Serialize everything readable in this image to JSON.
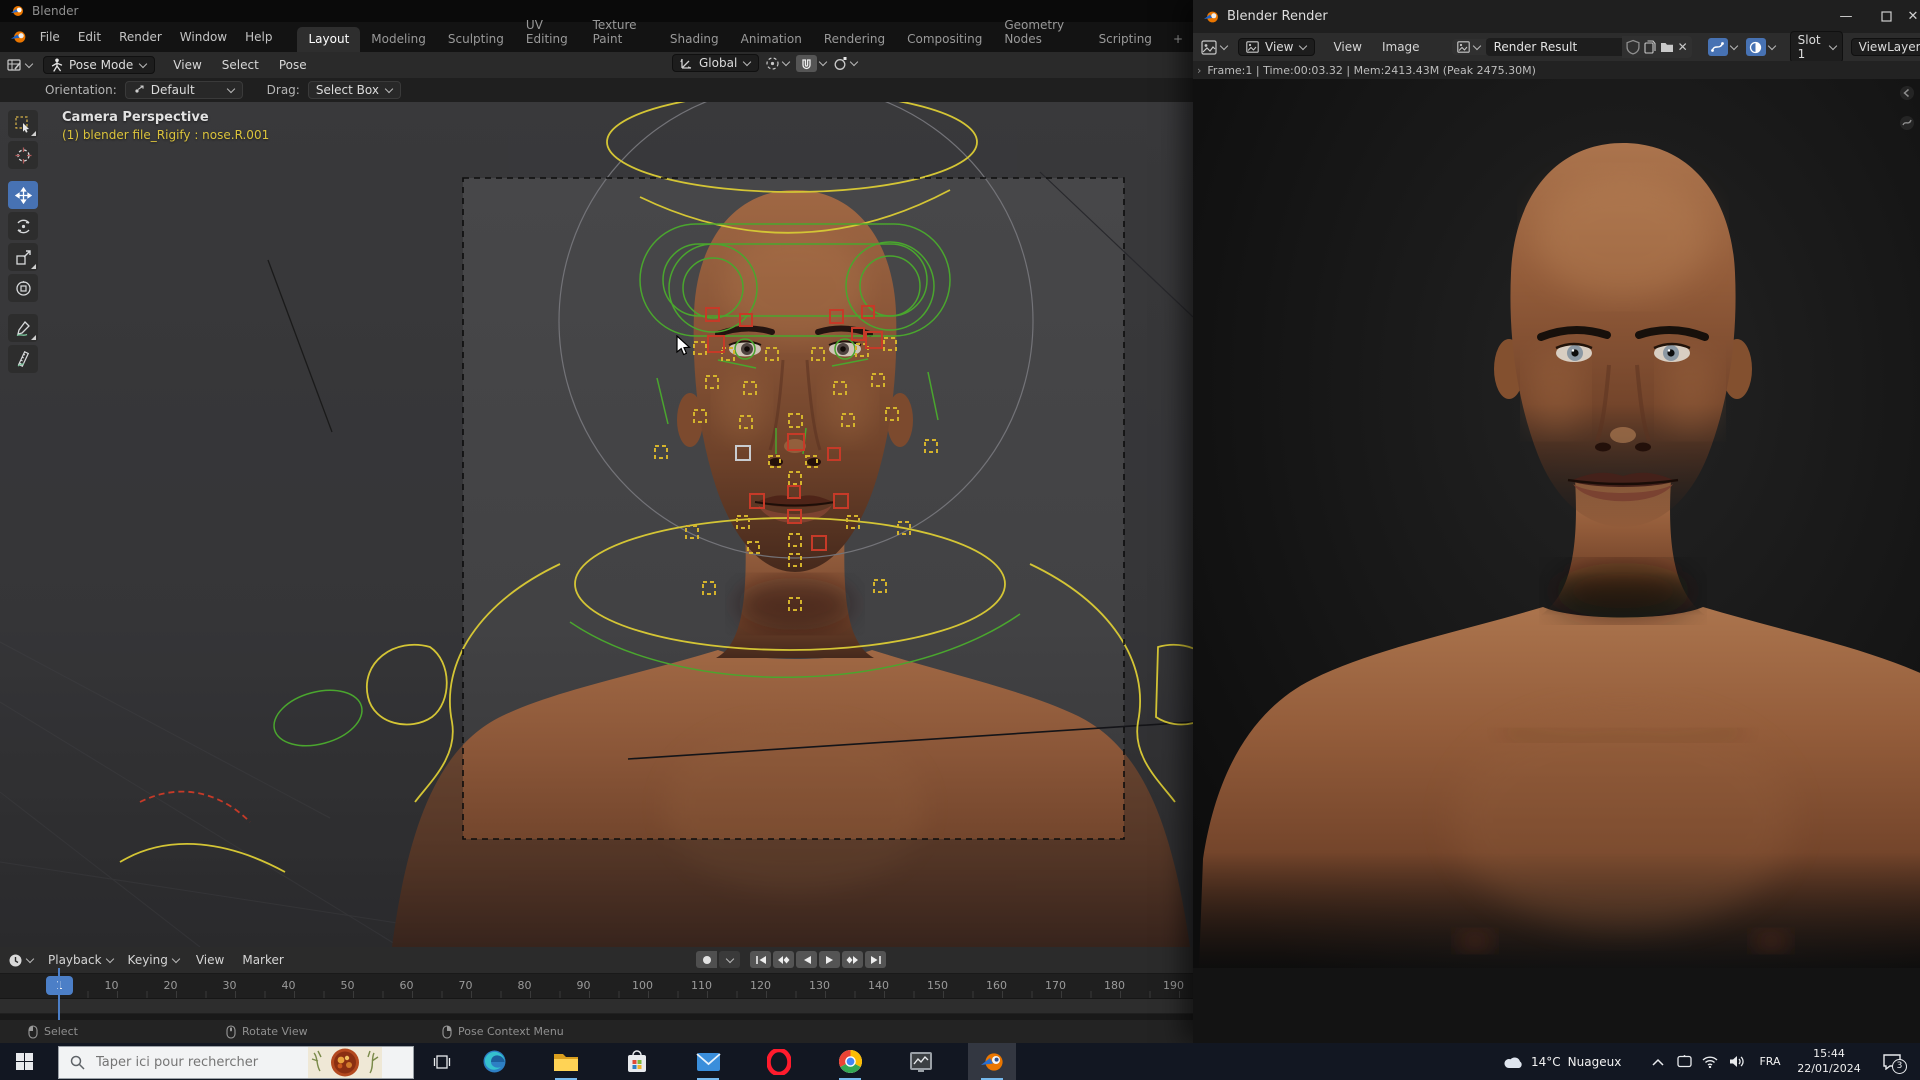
{
  "os": {
    "main_title": "Blender"
  },
  "topbar": {
    "menus": [
      "File",
      "Edit",
      "Render",
      "Window",
      "Help"
    ],
    "workspaces": [
      "Layout",
      "Modeling",
      "Sculpting",
      "UV Editing",
      "Texture Paint",
      "Shading",
      "Animation",
      "Rendering",
      "Compositing",
      "Geometry Nodes",
      "Scripting"
    ],
    "new_tab": "+"
  },
  "vp_header": {
    "mode": "Pose Mode",
    "menus": [
      "View",
      "Select",
      "Pose"
    ],
    "orientation": "Global"
  },
  "tool_settings": {
    "orientation_label": "Orientation:",
    "orientation_value": "Default",
    "drag_label": "Drag:",
    "drag_value": "Select Box"
  },
  "viewport": {
    "view_label": "Camera Perspective",
    "breadcrumb": "(1) blender file_Rigify : nose.R.001",
    "tools": [
      "tweak-select",
      "cursor",
      "move",
      "rotate",
      "scale",
      "transform",
      "annotate",
      "measure"
    ],
    "active_tool": "move"
  },
  "timeline": {
    "menus": [
      "Playback",
      "Keying",
      "View",
      "Marker"
    ],
    "current_frame": "1",
    "frame_labels": [
      "10",
      "20",
      "30",
      "40",
      "50",
      "60",
      "70",
      "80",
      "90",
      "100",
      "110",
      "120",
      "130",
      "140",
      "150",
      "160",
      "170",
      "180",
      "190"
    ]
  },
  "status_hints": [
    "Select",
    "Rotate View",
    "Pose Context Menu"
  ],
  "render_window": {
    "title": "Blender Render",
    "display_mode": "View",
    "menus": [
      "View",
      "Image"
    ],
    "image_name": "Render Result",
    "slot": "Slot 1",
    "view_layer": "ViewLayer",
    "stats": "Frame:1 | Time:00:03.32 | Mem:2413.43M (Peak 2475.30M)"
  },
  "taskbar": {
    "search_placeholder": "Taper ici pour rechercher",
    "weather": {
      "temp": "14°C",
      "condition": "Nuageux"
    },
    "language": "FRA",
    "clock": {
      "time": "15:44",
      "date": "22/01/2024"
    },
    "notifications": "3",
    "icons": [
      "start",
      "task-view",
      "edge",
      "file-explorer",
      "ms-store",
      "mail",
      "opera",
      "chrome",
      "capture-app",
      "blender"
    ]
  },
  "colors": {
    "accent": "#4772b3",
    "rig_yellow": "#d4c535",
    "rig_green": "#4aa62e",
    "rig_red": "#c63a28"
  }
}
